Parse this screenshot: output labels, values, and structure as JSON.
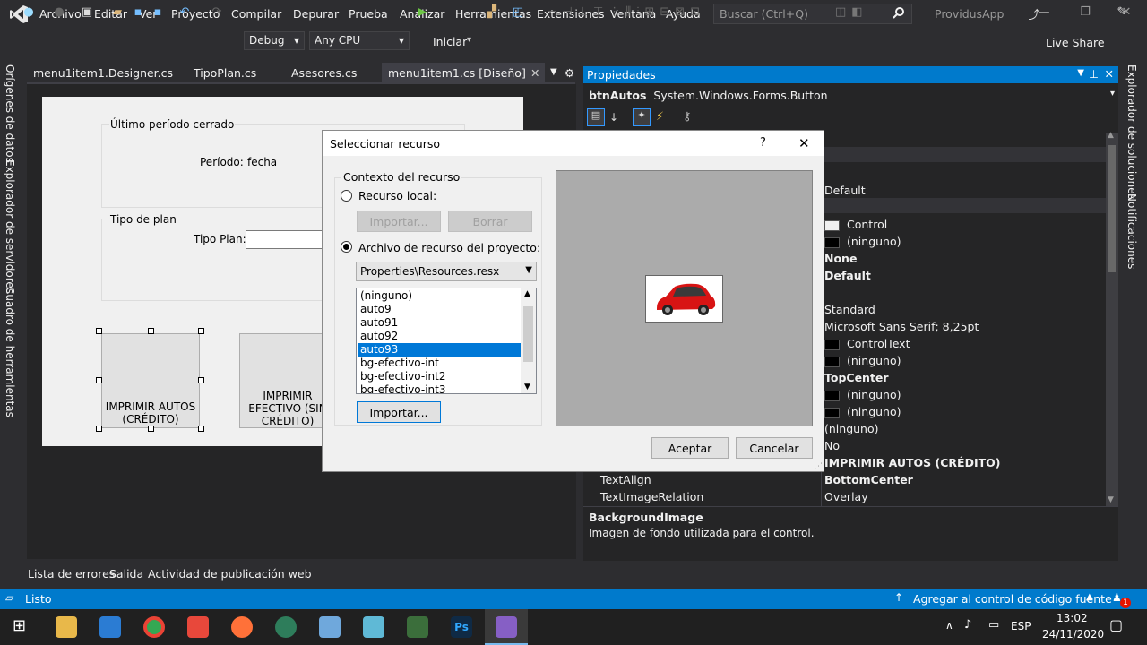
{
  "menu": {
    "items": [
      "Archivo",
      "Editar",
      "Ver",
      "Proyecto",
      "Compilar",
      "Depurar",
      "Prueba",
      "Analizar",
      "Herramientas",
      "Extensiones",
      "Ventana",
      "Ayuda"
    ],
    "search_placeholder": "Buscar (Ctrl+Q)",
    "app_name": "ProvidusApp"
  },
  "toolbar": {
    "config": "Debug",
    "platform": "Any CPU",
    "start_label": "Iniciar",
    "live_share": "Live Share"
  },
  "tabs": [
    {
      "label": "menu1item1.Designer.cs"
    },
    {
      "label": "TipoPlan.cs"
    },
    {
      "label": "Asesores.cs"
    },
    {
      "label": "menu1item1.cs [Diseño]"
    }
  ],
  "left_rail": [
    "Orígenes de datos",
    "Explorador de servidores",
    "Cuadro de herramientas"
  ],
  "right_rail": [
    "Explorador de soluciones",
    "Notificaciones"
  ],
  "form": {
    "group1_title": "Último período cerrado",
    "periodo_label": "Período:",
    "periodo_value": "fecha",
    "group2_title": "Tipo de plan",
    "tipo_plan_label": "Tipo Plan:",
    "btn_autos": "IMPRIMIR AUTOS (CRÉDITO)",
    "btn_efectivo": "IMPRIMIR EFECTIVO (SIN CRÉDITO)"
  },
  "bottom_tabs": [
    "Lista de errores",
    "Salida",
    "Actividad de publicación web"
  ],
  "properties": {
    "title": "Propiedades",
    "object_name": "btnAutos",
    "object_type": "System.Windows.Forms.Button",
    "rows": [
      {
        "value": "Default",
        "bold": false,
        "swatch": ""
      },
      {
        "value": "Control",
        "bold": false,
        "swatch": "#f0f0f0"
      },
      {
        "value": "(ninguno)",
        "bold": false,
        "swatch": "#000000"
      },
      {
        "value": "None",
        "bold": true,
        "swatch": ""
      },
      {
        "value": "Default",
        "bold": true,
        "swatch": ""
      },
      {
        "value": "Standard",
        "bold": false,
        "swatch": ""
      },
      {
        "value": "Microsoft Sans Serif; 8,25pt",
        "bold": false,
        "swatch": ""
      },
      {
        "value": "ControlText",
        "bold": false,
        "swatch": "#000000"
      },
      {
        "value": "(ninguno)",
        "bold": false,
        "swatch": "#000000"
      },
      {
        "value": "TopCenter",
        "bold": true,
        "swatch": ""
      },
      {
        "value": "(ninguno)",
        "bold": false,
        "swatch": "#000000"
      },
      {
        "value": "(ninguno)",
        "bold": false,
        "swatch": "#000000"
      },
      {
        "value": "(ninguno)",
        "bold": false,
        "swatch": ""
      },
      {
        "value": "No",
        "bold": false,
        "swatch": ""
      },
      {
        "value": "IMPRIMIR AUTOS (CRÉDITO)",
        "bold": true,
        "swatch": ""
      },
      {
        "value": "BottomCenter",
        "bold": true,
        "swatch": ""
      },
      {
        "value": "Overlay",
        "bold": false,
        "swatch": ""
      }
    ],
    "textalign_name": "TextAlign",
    "textimagerelation_name": "TextImageRelation",
    "desc_title": "BackgroundImage",
    "desc_text": "Imagen de fondo utilizada para el control."
  },
  "status": {
    "ready": "Listo",
    "source_control": "Agregar al control de código fuente",
    "notif_count": "1"
  },
  "taskbar": {
    "lang": "ESP",
    "time": "13:02",
    "date": "24/11/2020"
  },
  "dialog": {
    "title": "Seleccionar recurso",
    "help": "?",
    "group_title": "Contexto del recurso",
    "radio_local": "Recurso local:",
    "btn_importar_disabled": "Importar...",
    "btn_borrar": "Borrar",
    "radio_project": "Archivo de recurso del proyecto:",
    "resource_file": "Properties\\Resources.resx",
    "resources": [
      "(ninguno)",
      "auto9",
      "auto91",
      "auto92",
      "auto93",
      "bg-efectivo-int",
      "bg-efectivo-int2",
      "bg-efectivo-int3"
    ],
    "selected_index": 4,
    "btn_importar": "Importar...",
    "btn_aceptar": "Aceptar",
    "btn_cancelar": "Cancelar"
  },
  "colors": {
    "accent": "#007acc",
    "ide_bg": "#2d2d30",
    "selection": "#0078d7"
  }
}
